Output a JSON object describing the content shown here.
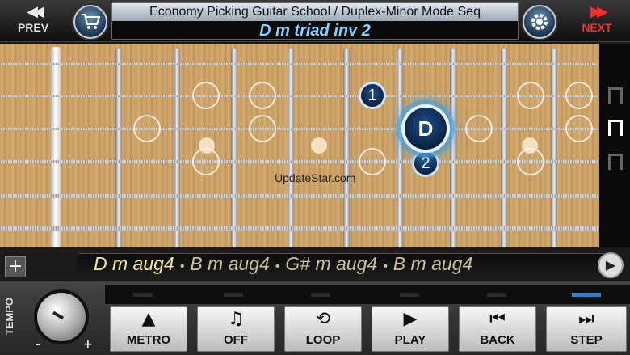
{
  "header": {
    "prev_label": "PREV",
    "next_label": "NEXT",
    "lesson_title": "Economy Picking Guitar School / Duplex-Minor Mode Seq",
    "chord_title": "D m triad inv 2"
  },
  "fretboard": {
    "root_note": "D",
    "finger_1": "1",
    "finger_2": "2",
    "watermark": "UpdateStar.com"
  },
  "sequence": {
    "items": [
      "D m aug4",
      "B m aug4",
      "G# m aug4",
      "B m aug4"
    ],
    "separator": "•",
    "add_label": "+"
  },
  "controls": {
    "tempo_label": "TEMPO",
    "knob_minus": "-",
    "knob_plus": "+",
    "buttons": {
      "metro": "METRO",
      "off": "OFF",
      "loop": "LOOP",
      "play": "PLAY",
      "back": "BACK",
      "step": "STEP"
    }
  },
  "colors": {
    "next_red": "#ff2a2a",
    "title_blue": "#7fd1ff",
    "sequence_yellow": "#f2ea8a",
    "beat_active": "#2a7fd0"
  },
  "icons": {
    "cart": "cart-icon",
    "gear": "gear-icon",
    "metronome": "triangle-up-icon",
    "note": "music-note-icon",
    "loop": "loop-icon",
    "play": "play-icon",
    "back": "skip-back-icon",
    "step": "skip-forward-icon"
  }
}
